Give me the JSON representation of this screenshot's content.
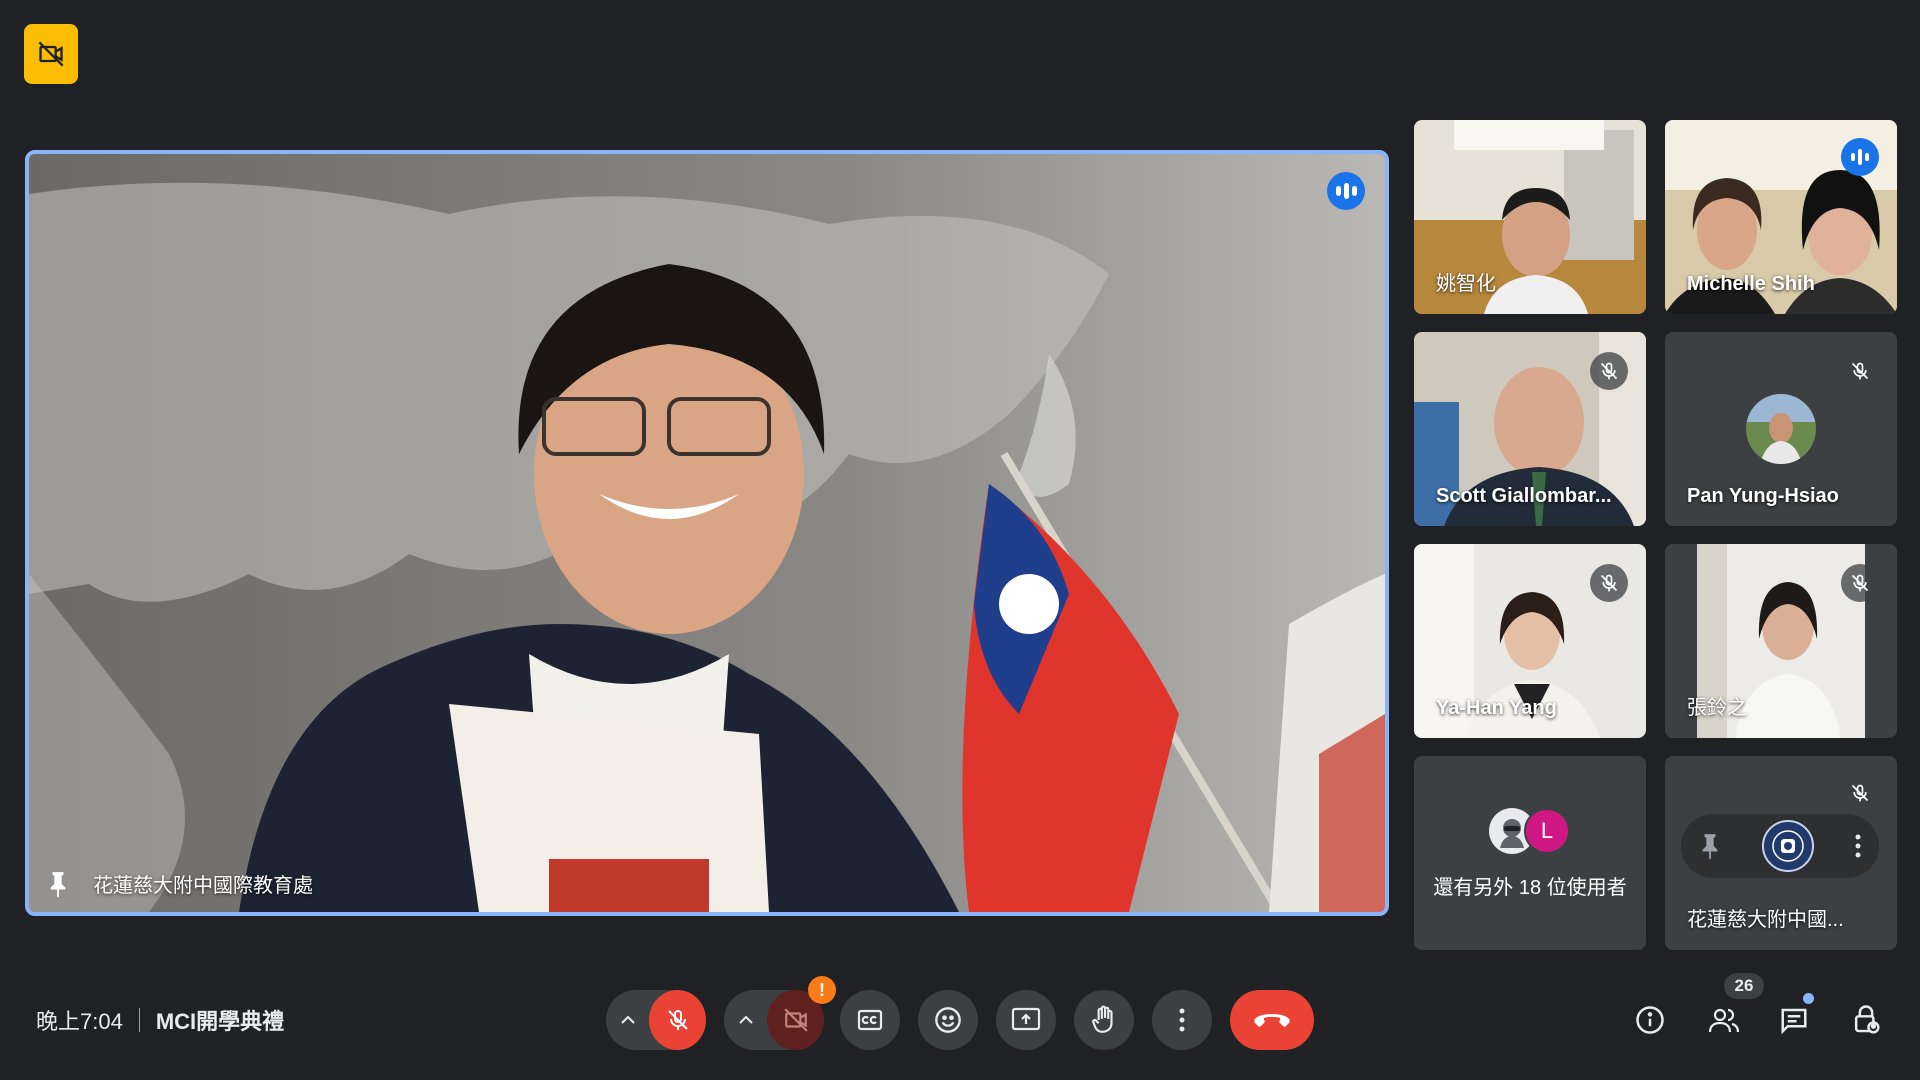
{
  "meeting": {
    "time": "晚上7:04",
    "title": "MCI開學典禮"
  },
  "main_speaker": {
    "name": "花蓮慈大附中國際教育處",
    "pinned": true,
    "speaking": true
  },
  "participants": [
    {
      "name": "姚智化",
      "muted": false
    },
    {
      "name": "Michelle Shih",
      "speaking": true
    },
    {
      "name": "Scott Giallombar...",
      "muted": true
    },
    {
      "name": "Pan Yung-Hsiao",
      "muted": true
    },
    {
      "name": "Ya-Han Yang",
      "muted": true
    },
    {
      "name": "張鈴之",
      "muted": true
    },
    {
      "name": "還有另外 18 位使用者",
      "avatar_letter": "L"
    },
    {
      "name": "花蓮慈大附中國...",
      "muted": true
    }
  ],
  "people_count": "26",
  "warning_glyph": "!",
  "colors": {
    "accent": "#8ab4f8",
    "hangup": "#ea4335",
    "speaking": "#1a73e8",
    "warning": "#fa7b17"
  }
}
